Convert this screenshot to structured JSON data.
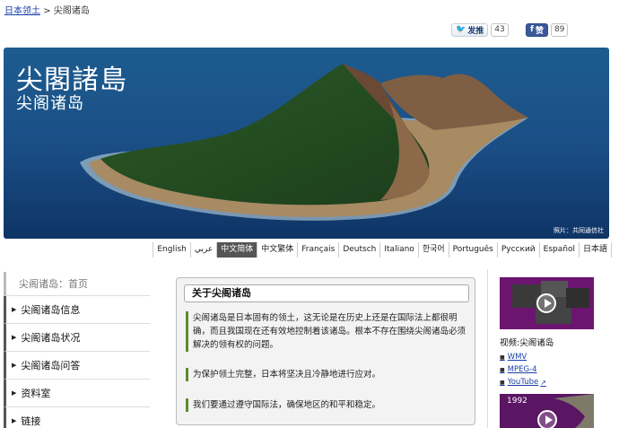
{
  "breadcrumb": {
    "home": "日本领土",
    "separator": ">",
    "current": "尖阁诸岛"
  },
  "social": {
    "weibo_label": "发推",
    "weibo_count": "43",
    "facebook_label": "赞",
    "facebook_count": "89"
  },
  "banner": {
    "title": "尖閣諸島",
    "subtitle": "尖阁诸岛",
    "credit": "照片：共同通信社"
  },
  "languages": [
    {
      "label": "English",
      "selected": false
    },
    {
      "label": "عربي",
      "selected": false
    },
    {
      "label": "中文简体",
      "selected": true
    },
    {
      "label": "中文繁体",
      "selected": false
    },
    {
      "label": "Français",
      "selected": false
    },
    {
      "label": "Deutsch",
      "selected": false
    },
    {
      "label": "Italiano",
      "selected": false
    },
    {
      "label": "한국어",
      "selected": false
    },
    {
      "label": "Português",
      "selected": false
    },
    {
      "label": "Русский",
      "selected": false
    },
    {
      "label": "Español",
      "selected": false
    },
    {
      "label": "日本語",
      "selected": false
    }
  ],
  "sidebar": {
    "home": "尖阁诸岛：首页",
    "items": [
      {
        "label": "尖阁诸岛信息"
      },
      {
        "label": "尖阁诸岛状况"
      },
      {
        "label": "尖阁诸岛问答"
      },
      {
        "label": "资料室"
      },
      {
        "label": "链接"
      }
    ]
  },
  "about": {
    "title": "关于尖阁诸岛",
    "paragraphs": [
      "尖阁诸岛是日本固有的领土，这无论是在历史上还是在国际法上都很明确，而且我国现在还有效地控制着该诸岛。根本不存在围绕尖阁诸岛必须解决的领有权的问题。",
      "为保护领土完整，日本将坚决且冷静地进行应对。",
      "我们要通过遵守国际法，确保地区的和平和稳定。"
    ]
  },
  "video": {
    "label": "视频:尖阁诸岛",
    "links": [
      {
        "label": "WMV"
      },
      {
        "label": "MPEG-4"
      },
      {
        "label": "YouTube"
      }
    ],
    "thumb2_year": "1992"
  },
  "colors": {
    "link": "#1a3fa8",
    "accent_green": "#5f8b2f",
    "video_purple": "#6b1570",
    "lang_selected_bg": "#555555"
  }
}
